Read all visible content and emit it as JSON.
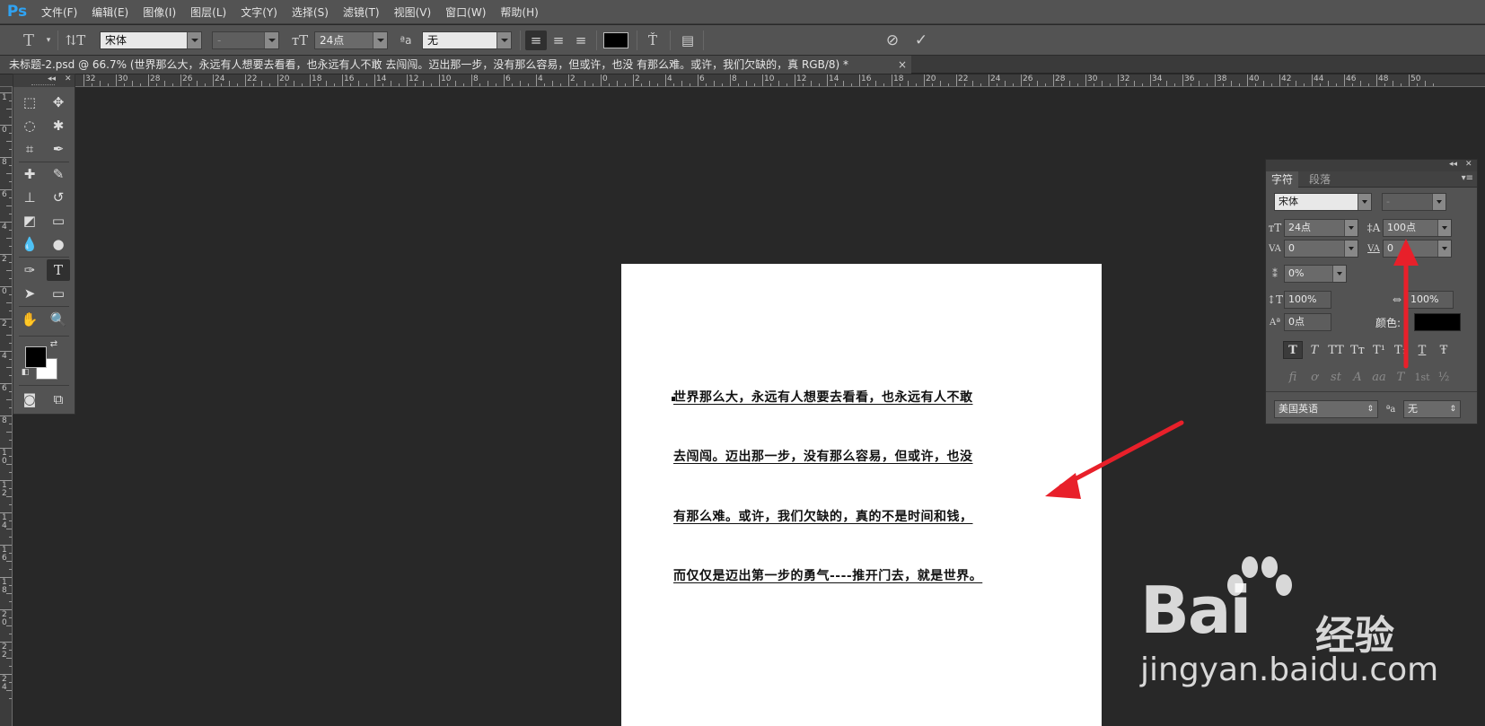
{
  "app": {
    "logo": "Ps"
  },
  "menu": [
    "文件(F)",
    "编辑(E)",
    "图像(I)",
    "图层(L)",
    "文字(Y)",
    "选择(S)",
    "滤镜(T)",
    "视图(V)",
    "窗口(W)",
    "帮助(H)"
  ],
  "options": {
    "font_family": "宋体",
    "font_style": "-",
    "font_size": "24点",
    "antialias_label": "ªa",
    "antialias": "无",
    "text_color": "#000000"
  },
  "document_tab": {
    "title": "未标题-2.psd @ 66.7% (世界那么大，永远有人想要去看看，也永远有人不敢 去闯闯。迈出那一步，没有那么容易，但或许，也没 有那么难。或许，我们欠缺的，真 RGB/8) *",
    "close": "×"
  },
  "ruler": {
    "horizontal": [
      "32",
      "30",
      "28",
      "26",
      "24",
      "22",
      "20",
      "18",
      "16",
      "14",
      "12",
      "10",
      "8",
      "6",
      "4",
      "2",
      "0",
      "2",
      "4",
      "6",
      "8",
      "10",
      "12",
      "14",
      "16",
      "18",
      "20",
      "22",
      "24",
      "26",
      "28",
      "30",
      "32",
      "34",
      "36",
      "38",
      "40",
      "42",
      "44",
      "46",
      "48",
      "50"
    ],
    "vertical": [
      "1",
      "0",
      "8",
      "6",
      "4",
      "2",
      "0",
      "2",
      "4",
      "6",
      "8",
      "1\n0",
      "1\n2",
      "1\n4",
      "1\n6",
      "1\n8",
      "2\n0",
      "2\n2",
      "2\n4"
    ]
  },
  "canvas_text": [
    "世界那么大，永远有人想要去看看，也永远有人不敢",
    "去闯闯。迈出那一步，没有那么容易，但或许，也没",
    "有那么难。或许，我们欠缺的，真的不是时间和钱，",
    "而仅仅是迈出第一步的勇气----推开门去，就是世界。"
  ],
  "character_panel": {
    "tabs": [
      "字符",
      "段落"
    ],
    "font_family": "宋体",
    "font_style": "-",
    "font_size": "24点",
    "leading": "100点",
    "kerning": "0",
    "tracking": "0",
    "tsume": "0%",
    "vertical_scale": "100%",
    "horizontal_scale": "100%",
    "baseline_shift": "0点",
    "color_label": "颜色:",
    "color": "#000000",
    "language": "美国英语",
    "antialias_label": "ªa",
    "antialias": "无",
    "styles": [
      "T",
      "T",
      "TT",
      "Tт",
      "T¹",
      "T₁",
      "T",
      "Ŧ"
    ],
    "opentype": [
      "fi",
      "ơ",
      "st",
      "A",
      "aa",
      "T",
      "1st",
      "½"
    ]
  },
  "watermark": {
    "brand": "Bai",
    "brand_cn": "经验",
    "url": "jingyan.baidu.com"
  },
  "annotation_color": "#e8202a"
}
